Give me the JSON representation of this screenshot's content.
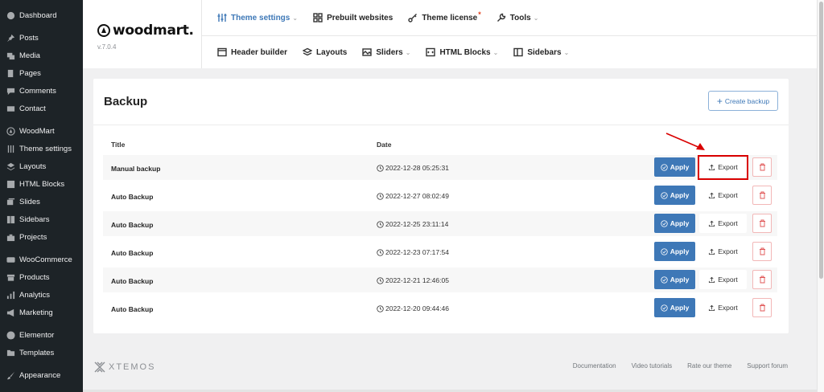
{
  "sidebar": {
    "items": [
      {
        "label": "Dashboard",
        "icon": "dashboard-icon"
      },
      {
        "label": "Posts",
        "icon": "pin-icon"
      },
      {
        "label": "Media",
        "icon": "media-icon"
      },
      {
        "label": "Pages",
        "icon": "pages-icon"
      },
      {
        "label": "Comments",
        "icon": "comment-icon"
      },
      {
        "label": "Contact",
        "icon": "mail-icon"
      },
      {
        "label": "WoodMart",
        "icon": "woodmart-icon"
      },
      {
        "label": "Theme settings",
        "icon": "sliders-icon"
      },
      {
        "label": "Layouts",
        "icon": "layers-icon"
      },
      {
        "label": "HTML Blocks",
        "icon": "html-icon"
      },
      {
        "label": "Slides",
        "icon": "slides-icon"
      },
      {
        "label": "Sidebars",
        "icon": "sidebar-icon"
      },
      {
        "label": "Projects",
        "icon": "briefcase-icon"
      },
      {
        "label": "WooCommerce",
        "icon": "woo-icon"
      },
      {
        "label": "Products",
        "icon": "archive-icon"
      },
      {
        "label": "Analytics",
        "icon": "chart-icon"
      },
      {
        "label": "Marketing",
        "icon": "megaphone-icon"
      },
      {
        "label": "Elementor",
        "icon": "elementor-icon"
      },
      {
        "label": "Templates",
        "icon": "folder-icon"
      },
      {
        "label": "Appearance",
        "icon": "brush-icon"
      }
    ]
  },
  "brand": {
    "name": "woodmart.",
    "version": "v.7.0.4"
  },
  "topnav": {
    "row1": [
      {
        "label": "Theme settings",
        "icon": "sliders-icon",
        "chevron": true,
        "active": true
      },
      {
        "label": "Prebuilt websites",
        "icon": "grid-icon",
        "chevron": false
      },
      {
        "label": "Theme license",
        "icon": "key-icon",
        "chevron": false,
        "star": "*"
      },
      {
        "label": "Tools",
        "icon": "wrench-icon",
        "chevron": true
      }
    ],
    "row2": [
      {
        "label": "Header builder",
        "icon": "header-icon",
        "chevron": false
      },
      {
        "label": "Layouts",
        "icon": "layers-icon",
        "chevron": false
      },
      {
        "label": "Sliders",
        "icon": "image-icon",
        "chevron": true
      },
      {
        "label": "HTML Blocks",
        "icon": "html-icon",
        "chevron": true
      },
      {
        "label": "Sidebars",
        "icon": "sidebar-icon",
        "chevron": true
      }
    ]
  },
  "backup": {
    "title": "Backup",
    "create_label": "Create backup",
    "columns": {
      "title": "Title",
      "date": "Date"
    },
    "apply_label": "Apply",
    "export_label": "Export",
    "rows": [
      {
        "title": "Manual backup",
        "date": "2022-12-28 05:25:31"
      },
      {
        "title": "Auto Backup",
        "date": "2022-12-27 08:02:49"
      },
      {
        "title": "Auto Backup",
        "date": "2022-12-25 23:11:14"
      },
      {
        "title": "Auto Backup",
        "date": "2022-12-23 07:17:54"
      },
      {
        "title": "Auto Backup",
        "date": "2022-12-21 12:46:05"
      },
      {
        "title": "Auto Backup",
        "date": "2022-12-20 09:44:46"
      }
    ]
  },
  "footer": {
    "logo": "XTEMOS",
    "links": [
      "Documentation",
      "Video tutorials",
      "Rate our theme",
      "Support forum"
    ]
  },
  "colors": {
    "accent": "#3e78b7",
    "sidebar_bg": "#1d2327",
    "highlight": "#d90000"
  }
}
